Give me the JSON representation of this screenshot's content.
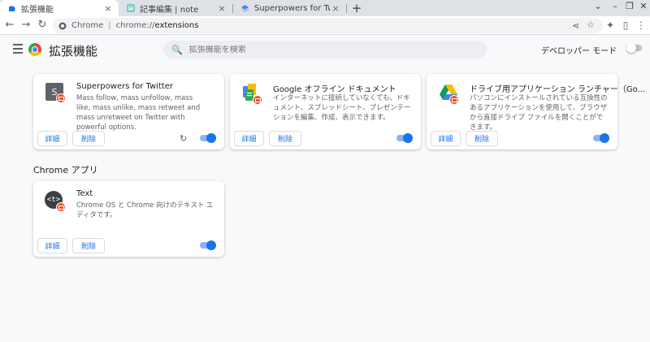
{
  "tabs": [
    {
      "title": "拡張機能",
      "close": "×",
      "icon": "puzzle-icon",
      "active": true
    },
    {
      "title": "記事編集 | note",
      "close": "×",
      "icon": "note-icon",
      "active": false
    },
    {
      "title": "Superpowers for Twitter",
      "close": "×",
      "icon": "extension-page-icon",
      "active": false
    }
  ],
  "new_tab": "+",
  "window_controls": {
    "chevron": "⌄",
    "minimize": "–",
    "restore": "❐",
    "close": "✕"
  },
  "toolbar": {
    "back": "←",
    "forward": "→",
    "reload": "↻",
    "chip": "Chrome",
    "separator": "|",
    "url_scheme": "chrome://",
    "url_path": "extensions",
    "share": "⋖",
    "star": "☆",
    "extensions": "✦",
    "sidepanel": "▯",
    "menu": "⋮"
  },
  "header": {
    "title": "拡張機能",
    "search_placeholder": "拡張機能を検索",
    "search_icon": "🔍",
    "dev_mode_label": "デベロッパー モード",
    "dev_mode_on": false
  },
  "extensions": [
    {
      "name": "Superpowers for Twitter",
      "description": "Mass follow, mass unfollow, mass like, mass unlike, mass retweet and mass unretweet on Twitter with powerful options.",
      "icon_letter": "S",
      "details_label": "詳細",
      "remove_label": "削除",
      "reload": "↻",
      "enabled": true
    },
    {
      "name": "Google オフライン ドキュメント",
      "description": "インターネットに接続していなくても、ドキュメント、スプレッドシート、プレゼンテーションを編集、作成、表示できます。",
      "details_label": "詳細",
      "remove_label": "削除",
      "enabled": true
    },
    {
      "name": "ドライブ用アプリケーション ランチャー（Go...",
      "description": "パソコンにインストールされている互換性のあるアプリケーションを使用して、ブラウザから直接ドライブ ファイルを開くことができます。",
      "details_label": "詳細",
      "remove_label": "削除",
      "enabled": true
    }
  ],
  "apps_section_title": "Chrome アプリ",
  "apps": [
    {
      "name": "Text",
      "description": "Chrome OS と Chrome 向けのテキスト エディタです。",
      "icon_text": "<t>",
      "details_label": "詳細",
      "remove_label": "削除",
      "enabled": true
    }
  ],
  "colors": {
    "accent": "#1a73e8",
    "toggle_track": "#8ab4f8",
    "badge": "#e8502f"
  }
}
